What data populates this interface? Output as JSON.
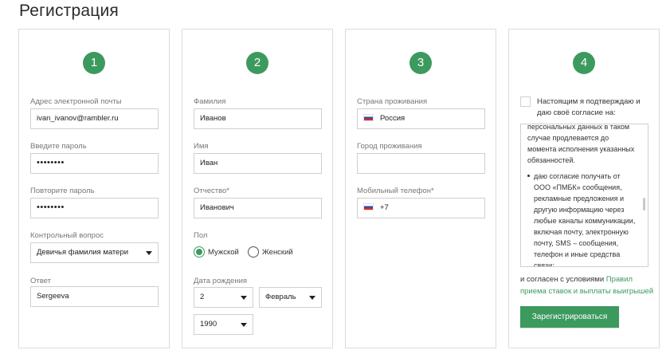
{
  "page": {
    "title": "Регистрация"
  },
  "colors": {
    "accent": "#3c9a5f",
    "border": "#dcdcdc",
    "label": "#777777"
  },
  "step1": {
    "number": "1",
    "email_label": "Адрес электронной почты",
    "email_value": "ivan_ivanov@rambler.ru",
    "password_label": "Введите пароль",
    "password_value": "••••••••",
    "password_repeat_label": "Повторите пароль",
    "password_repeat_value": "••••••••",
    "question_label": "Контрольный вопрос",
    "question_value": "Девичья фамилия матери",
    "answer_label": "Ответ",
    "answer_value": "Sergeeva"
  },
  "step2": {
    "number": "2",
    "lastname_label": "Фамилия",
    "lastname_value": "Иванов",
    "firstname_label": "Имя",
    "firstname_value": "Иван",
    "patronymic_label": "Отчество*",
    "patronymic_value": "Иванович",
    "gender_label": "Пол",
    "gender_male": "Мужской",
    "gender_female": "Женский",
    "gender_selected": "Мужской",
    "birthdate_label": "Дата рождения",
    "day": "2",
    "month": "Февраль",
    "year": "1990"
  },
  "step3": {
    "number": "3",
    "country_label": "Страна проживания",
    "country_value": "Россия",
    "country_flag_icon": "russia-flag-icon",
    "city_label": "Город проживания",
    "city_value": "",
    "phone_label": "Мобильный телефон*",
    "phone_value": "+7",
    "phone_flag_icon": "russia-flag-icon"
  },
  "step4": {
    "number": "4",
    "agree_text": "Настоящим я подтверждаю и даю своё согласие на:",
    "agree_checked": false,
    "terms_para1": "персональных данных в таком случае продлевается до момента исполнения указанных обязанностей.",
    "terms_bullet1": "даю согласие получать от ООО «ПМБК» сообщения, рекламные предложения и другую информацию через любые каналы коммуникации, включая почту, электронную почту, SMS – сообщения, телефон и иные средства связи;",
    "footer_prefix": "и согласен с условиями",
    "footer_link": "Правил приема ставок и выплаты выигрышей",
    "register_button": "Зарегистрироваться"
  }
}
